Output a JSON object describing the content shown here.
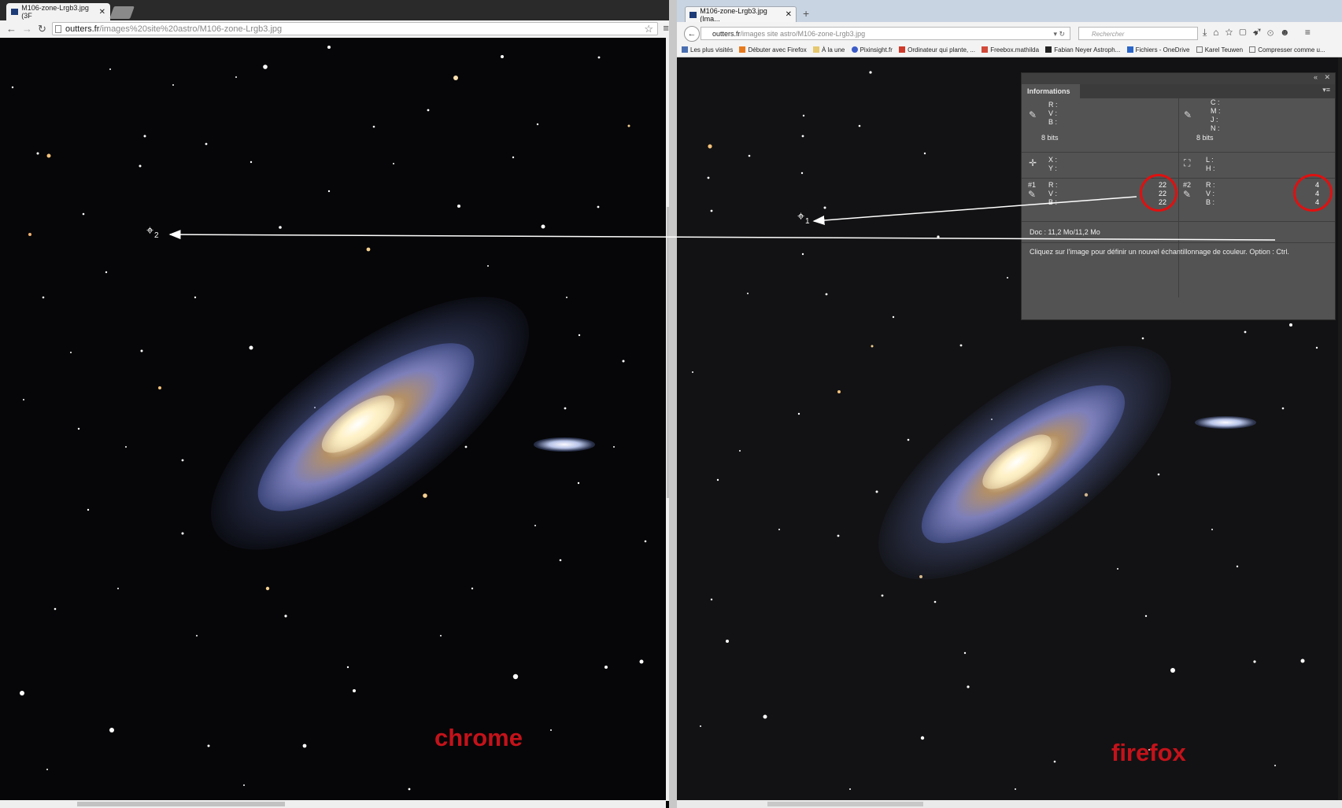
{
  "chrome": {
    "tab_title": "M106-zone-Lrgb3.jpg (3F",
    "url_host": "outters.fr",
    "url_path": "/images%20site%20astro/M106-zone-Lrgb3.jpg",
    "label": "chrome"
  },
  "firefox": {
    "tab_title": "M106-zone-Lrgb3.jpg (Ima...",
    "url_host": "outters.fr",
    "url_path": "/images site astro/M106-zone-Lrgb3.jpg",
    "search_placeholder": "Rechercher",
    "bookmarks": [
      "Les plus visités",
      "Débuter avec Firefox",
      "À la une",
      "Pixinsight.fr",
      "Ordinateur qui plante, ...",
      "Freebox.mathilda",
      "Fabian Neyer Astroph...",
      "Fichiers - OneDrive",
      "Karel Teuwen",
      "Compresser comme u..."
    ],
    "label": "firefox"
  },
  "info_panel": {
    "title": "Informations",
    "rgb_labels": [
      "R :",
      "V :",
      "B :"
    ],
    "cmyk_labels": [
      "C :",
      "M :",
      "J :",
      "N :"
    ],
    "bits_left": "8 bits",
    "bits_right": "8 bits",
    "xy_labels": [
      "X :",
      "Y :"
    ],
    "lh_labels": [
      "L :",
      "H :"
    ],
    "sample1_id": "#1",
    "sample1_values": [
      "22",
      "22",
      "22"
    ],
    "sample2_id": "#2",
    "sample2_values": [
      "4",
      "4",
      "4"
    ],
    "doc": "Doc : 11,2 Mo/11,2 Mo",
    "hint": "Cliquez sur l'image pour définir un nouvel échantillonnage de couleur. Option : Ctrl."
  },
  "markers": {
    "m1": "1",
    "m2": "2"
  },
  "colors": {
    "label_red": "#c4121a",
    "circle_red": "#e01010",
    "panel_bg": "#535353"
  }
}
